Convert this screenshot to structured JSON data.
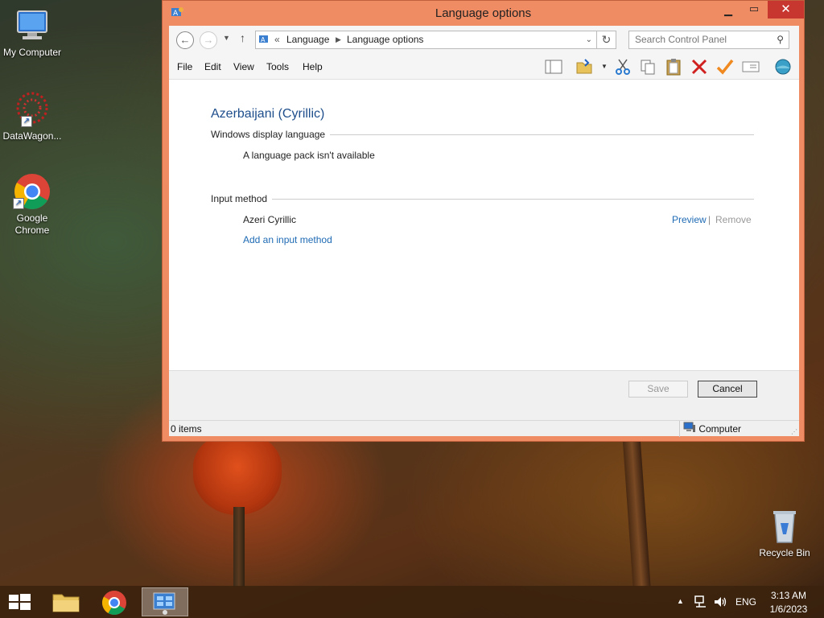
{
  "desktop": {
    "icons": [
      {
        "label": "My Computer"
      },
      {
        "label": "DataWagon..."
      },
      {
        "label": "Google Chrome"
      },
      {
        "label": "Recycle Bin"
      }
    ]
  },
  "window": {
    "title": "Language options",
    "address": {
      "prefix": "«",
      "crumb1": "Language",
      "crumb2": "Language options"
    },
    "search_placeholder": "Search Control Panel",
    "menu": [
      "File",
      "Edit",
      "View",
      "Tools",
      "Help"
    ],
    "content": {
      "language_name": "Azerbaijani (Cyrillic)",
      "display_section": "Windows display language",
      "display_status": "A language pack isn't available",
      "input_section": "Input method",
      "input_method_name": "Azeri Cyrillic",
      "preview_link": "Preview",
      "separator": "|",
      "remove_link": "Remove",
      "add_input_link": "Add an input method"
    },
    "buttons": {
      "save": "Save",
      "cancel": "Cancel"
    },
    "status": {
      "items": "0 items",
      "location": "Computer"
    }
  },
  "taskbar": {
    "tray": {
      "language": "ENG",
      "time": "3:13 AM",
      "date": "1/6/2023"
    }
  },
  "colors": {
    "window_frame": "#f08c64",
    "close_button": "#c7372f",
    "link": "#1e6ab4",
    "heading": "#1e4e8c"
  }
}
